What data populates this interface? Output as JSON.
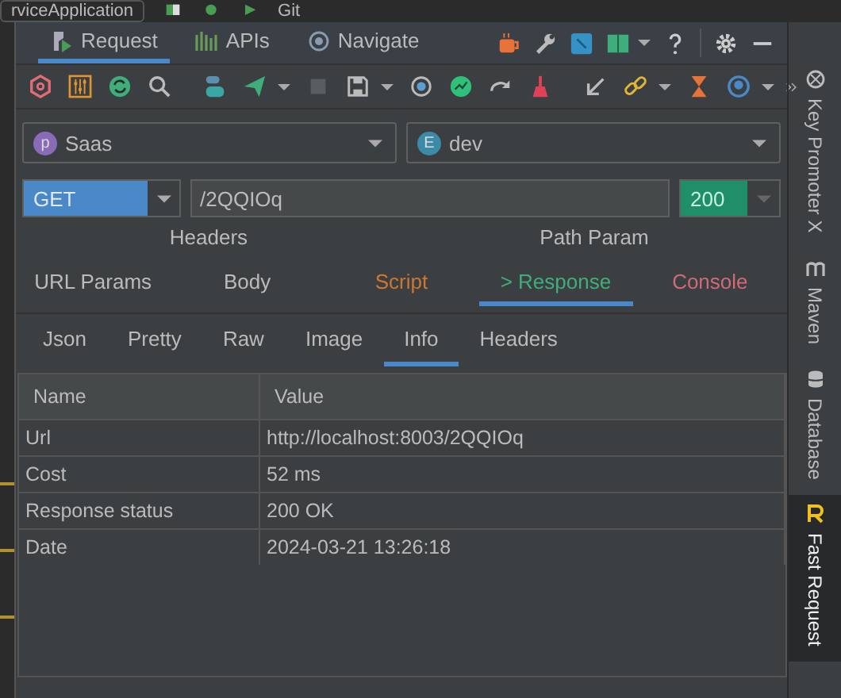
{
  "ide_bar": {
    "run_config": "rviceApplication",
    "vcs": "Git"
  },
  "tool_tabs": [
    {
      "label": "Request",
      "selected": true
    },
    {
      "label": "APIs",
      "selected": false
    },
    {
      "label": "Navigate",
      "selected": false
    }
  ],
  "project": {
    "badge": "p",
    "name": "Saas"
  },
  "env": {
    "badge": "E",
    "name": "dev"
  },
  "request": {
    "method": "GET",
    "url": "/2QQIOq",
    "status": "200"
  },
  "request_tabs": [
    [
      {
        "label": "Headers",
        "selected": false,
        "color": "#bbbbbb"
      },
      {
        "label": "Path Param",
        "selected": false,
        "color": "#bbbbbb"
      }
    ],
    [
      {
        "label": "URL Params",
        "selected": false,
        "color": "#bbbbbb"
      },
      {
        "label": "Body",
        "selected": false,
        "color": "#bbbbbb"
      },
      {
        "label": "Script",
        "selected": false,
        "color": "#cc7832"
      },
      {
        "label": "> Response",
        "selected": true,
        "color": "#3fae7c"
      },
      {
        "label": "Console",
        "selected": false,
        "color": "#d0697a"
      }
    ]
  ],
  "response_tabs": [
    {
      "label": "Json",
      "selected": false
    },
    {
      "label": "Pretty",
      "selected": false
    },
    {
      "label": "Raw",
      "selected": false
    },
    {
      "label": "Image",
      "selected": false
    },
    {
      "label": "Info",
      "selected": true
    },
    {
      "label": "Headers",
      "selected": false
    }
  ],
  "table": {
    "columns": [
      "Name",
      "Value"
    ],
    "rows": [
      [
        "Url",
        "http://localhost:8003/2QQIOq"
      ],
      [
        "Cost",
        "52 ms"
      ],
      [
        "Response status",
        "200 OK"
      ],
      [
        "Date",
        "2024-03-21 13:26:18"
      ]
    ]
  },
  "side_tools": [
    {
      "label": "Key Promoter X",
      "kind": "key",
      "selected": false
    },
    {
      "label": "Maven",
      "kind": "maven",
      "selected": false
    },
    {
      "label": "Database",
      "kind": "database",
      "selected": false
    },
    {
      "label": "Fast Request",
      "kind": "fast",
      "selected": true
    }
  ]
}
